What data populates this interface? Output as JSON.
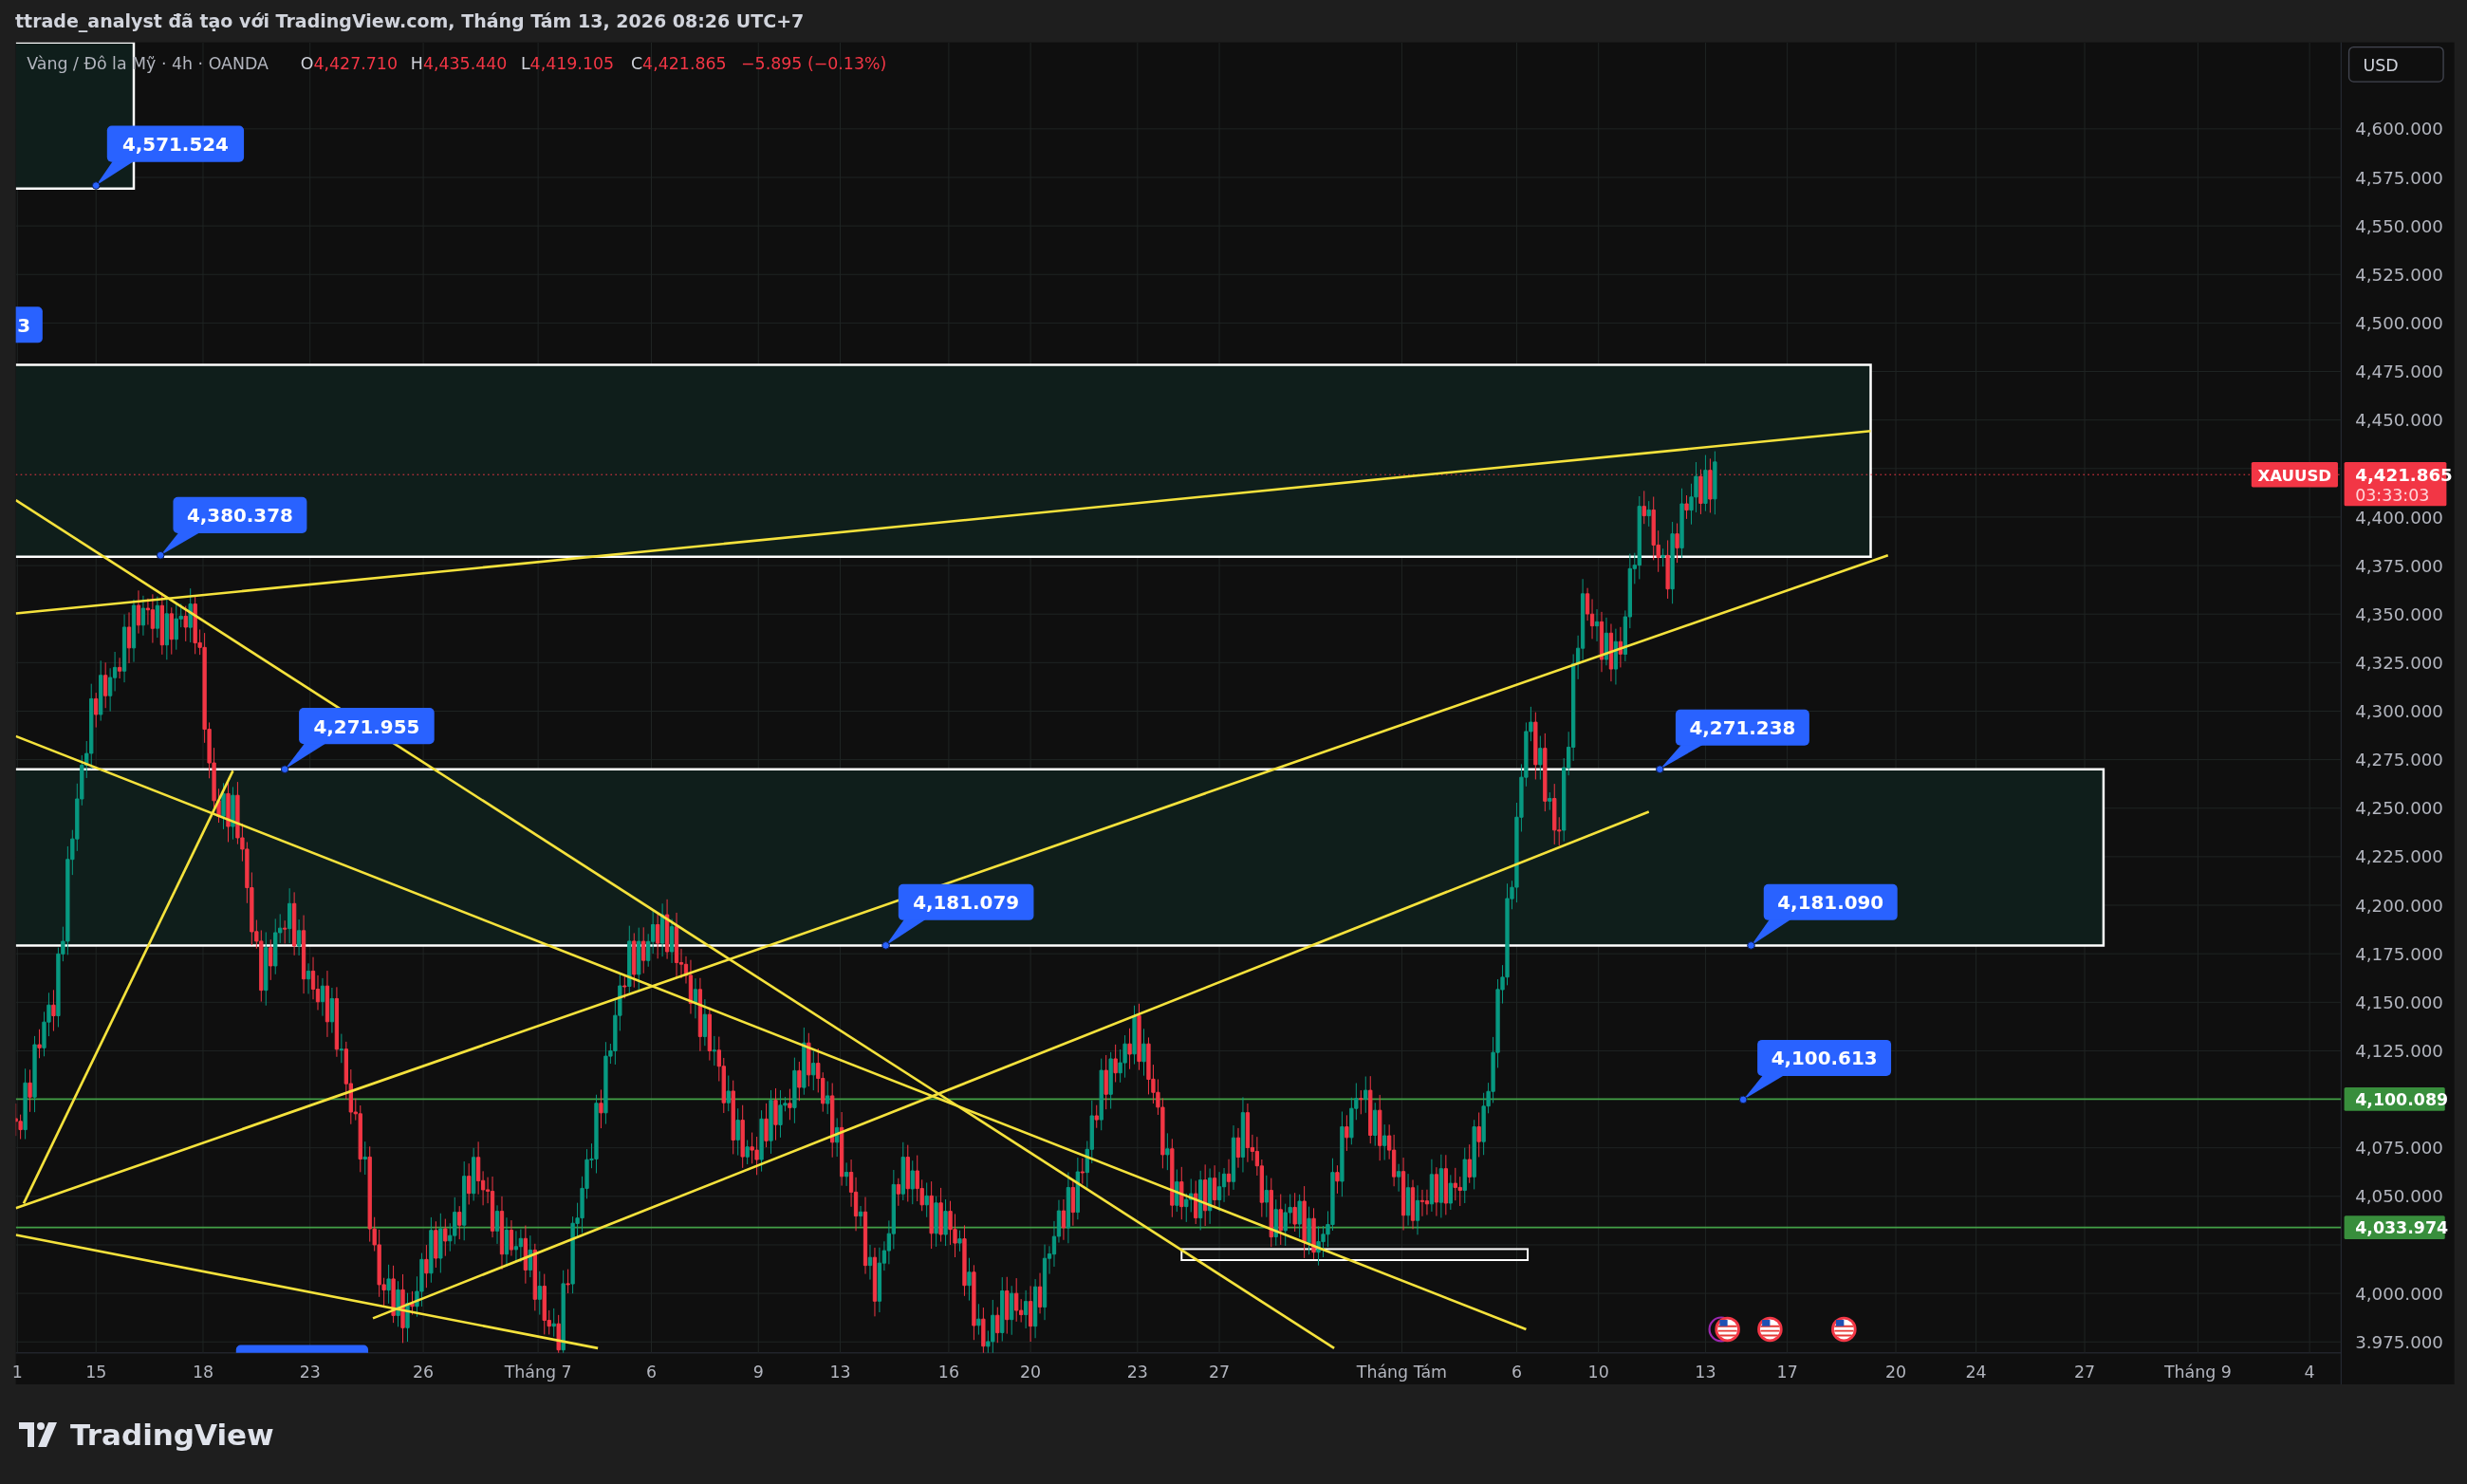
{
  "header": {
    "title": "ttrade_analyst đã tạo với TradingView.com, Tháng Tám 13, 2026 08:26 UTC+7"
  },
  "legend": {
    "symbol": "Vàng / Đô la Mỹ · 4h · OANDA",
    "ohlc": [
      {
        "label": "O",
        "value": "4,427.710"
      },
      {
        "label": "H",
        "value": "4,435.440"
      },
      {
        "label": "L",
        "value": "4,419.105"
      },
      {
        "label": "C",
        "value": "4,421.865"
      }
    ],
    "change": "−5.895 (−0.13%)"
  },
  "currency_button": "USD",
  "price_axis": {
    "ticks": [
      "4,600.000",
      "4,575.000",
      "4,550.000",
      "4,525.000",
      "4,500.000",
      "4,475.000",
      "4,450.000",
      "4,400.000",
      "4,375.000",
      "4,350.000",
      "4,325.000",
      "4,300.000",
      "4,275.000",
      "4,250.000",
      "4,225.000",
      "4,200.000",
      "4,175.000",
      "4,150.000",
      "4,125.000",
      "4,075.000",
      "4,050.000",
      "4,000.000",
      "3.975.000"
    ]
  },
  "current_price": {
    "symbol": "XAUUSD",
    "price": "4,421.865",
    "countdown": "03:33:03"
  },
  "level_tags": [
    {
      "price": "4,100.089"
    },
    {
      "price": "4,033.974"
    }
  ],
  "callouts": [
    "4,571.524",
    "3",
    "4,380.378",
    "4,271.955",
    "4,181.079",
    "4,271.238",
    "4,181.090",
    "4,100.613"
  ],
  "time_axis": {
    "labels": [
      "1",
      "15",
      "18",
      "23",
      "26",
      "Tháng 7",
      "6",
      "9",
      "13",
      "16",
      "20",
      "23",
      "27",
      "Tháng Tám",
      "6",
      "10",
      "13",
      "17",
      "20",
      "24",
      "27",
      "Tháng 9",
      "4"
    ]
  },
  "footer": {
    "brand": "TradingView"
  }
}
